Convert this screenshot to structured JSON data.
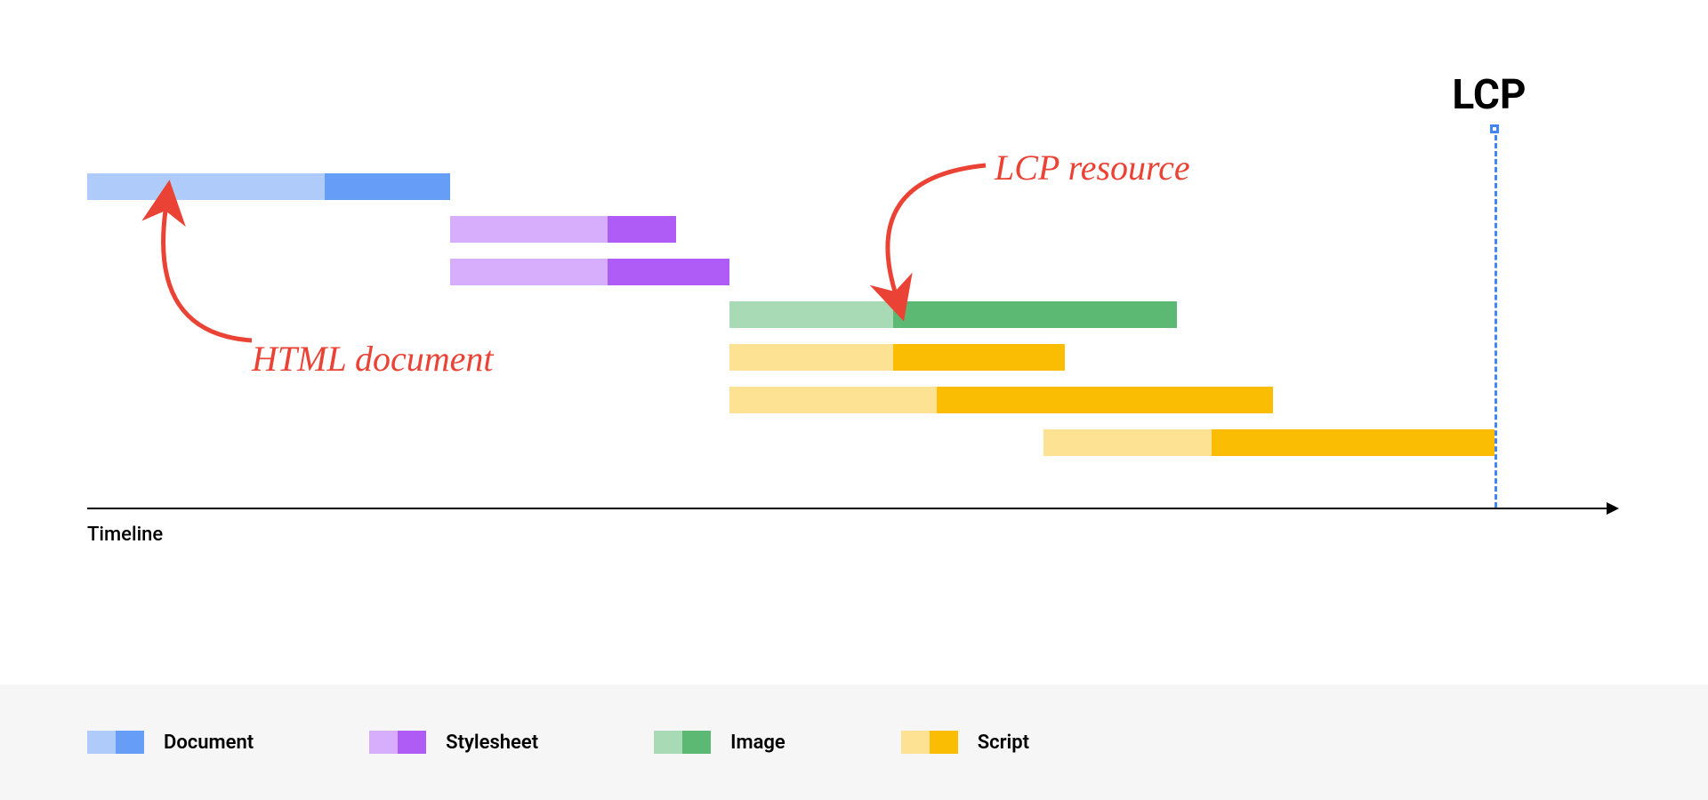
{
  "chart_data": {
    "type": "gantt-timeline",
    "title": "",
    "xlabel": "Timeline",
    "lcp_marker_label": "LCP",
    "lcp_position_pct": 92,
    "bars": [
      {
        "category": "Document",
        "start_pct": 0,
        "phase1_pct": 15.5,
        "phase2_pct": 8.2,
        "row": 0
      },
      {
        "category": "Stylesheet",
        "start_pct": 23.7,
        "phase1_pct": 10.3,
        "phase2_pct": 4.5,
        "row": 1
      },
      {
        "category": "Stylesheet",
        "start_pct": 23.7,
        "phase1_pct": 10.3,
        "phase2_pct": 8.0,
        "row": 2
      },
      {
        "category": "Image",
        "start_pct": 42.0,
        "phase1_pct": 10.7,
        "phase2_pct": 18.5,
        "row": 3
      },
      {
        "category": "Script",
        "start_pct": 42.0,
        "phase1_pct": 10.7,
        "phase2_pct": 11.2,
        "row": 4
      },
      {
        "category": "Script",
        "start_pct": 42.0,
        "phase1_pct": 13.5,
        "phase2_pct": 22.0,
        "row": 5
      },
      {
        "category": "Script",
        "start_pct": 62.5,
        "phase1_pct": 11.0,
        "phase2_pct": 18.5,
        "row": 6
      }
    ],
    "annotations": [
      {
        "text": "HTML document",
        "target_bar": 0
      },
      {
        "text": "LCP resource",
        "target_bar": 3
      }
    ],
    "legend": [
      {
        "label": "Document",
        "light": "#aecbfa",
        "dark": "#669df6"
      },
      {
        "label": "Stylesheet",
        "light": "#d7aefb",
        "dark": "#af5cf7"
      },
      {
        "label": "Image",
        "light": "#a8dab5",
        "dark": "#5bb974"
      },
      {
        "label": "Script",
        "light": "#fde293",
        "dark": "#fbbc04"
      }
    ],
    "category_colors": {
      "Document": {
        "light": "#aecbfa",
        "dark": "#669df6"
      },
      "Stylesheet": {
        "light": "#d7aefb",
        "dark": "#af5cf7"
      },
      "Image": {
        "light": "#a8dab5",
        "dark": "#5bb974"
      },
      "Script": {
        "light": "#fde293",
        "dark": "#fbbc04"
      }
    }
  }
}
